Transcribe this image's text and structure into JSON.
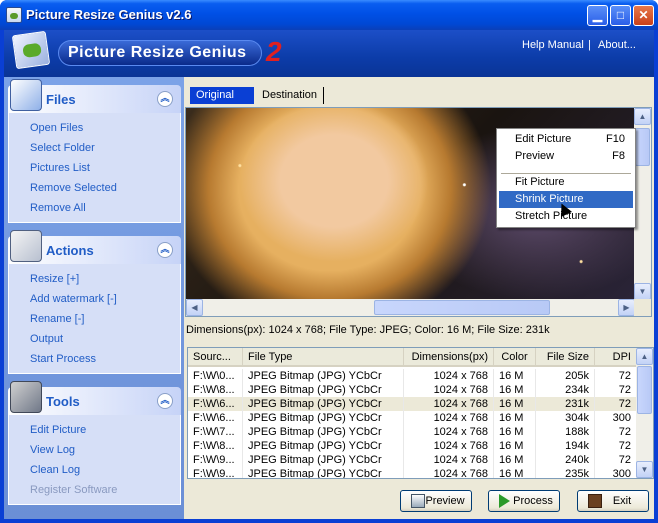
{
  "window": {
    "title": "Picture Resize Genius  v2.6"
  },
  "banner": {
    "logo_text": "Picture Resize Genius",
    "logo_version": "2",
    "help_link": "Help Manual",
    "separator": "|",
    "about_link": "About..."
  },
  "sidebar": {
    "files": {
      "title": "Files",
      "items": [
        "Open Files",
        "Select Folder",
        "Pictures List",
        "Remove Selected",
        "Remove All"
      ]
    },
    "actions": {
      "title": "Actions",
      "items": [
        "Resize [+]",
        "Add watermark [-]",
        "Rename [-]",
        "Output",
        "Start Process"
      ]
    },
    "tools": {
      "title": "Tools",
      "items": [
        "Edit Picture",
        "View Log",
        "Clean Log",
        "Register Software"
      ]
    }
  },
  "tabs": {
    "original": "Original",
    "destination": "Destination"
  },
  "context_menu": {
    "items": [
      {
        "label": "Edit Picture",
        "shortcut": "F10"
      },
      {
        "label": "Preview",
        "shortcut": "F8"
      },
      {
        "label": "Fit Picture",
        "shortcut": ""
      },
      {
        "label": "Shrink Picture",
        "shortcut": ""
      },
      {
        "label": "Stretch Picture",
        "shortcut": ""
      }
    ],
    "highlighted": "Shrink Picture"
  },
  "image_info": "Dimensions(px): 1024 x 768; File Type: JPEG; Color: 16 M; File Size: 231k",
  "table": {
    "columns": [
      "Sourc...",
      "File Type",
      "Dimensions(px)",
      "Color",
      "File Size",
      "DPI"
    ],
    "rows": [
      [
        "F:\\W\\0...",
        "JPEG Bitmap (JPG) YCbCr",
        "1024 x 768",
        "16 M",
        "205k",
        "72"
      ],
      [
        "F:\\W\\8...",
        "JPEG Bitmap (JPG) YCbCr",
        "1024 x 768",
        "16 M",
        "234k",
        "72"
      ],
      [
        "F:\\W\\6...",
        "JPEG Bitmap (JPG) YCbCr",
        "1024 x 768",
        "16 M",
        "231k",
        "72"
      ],
      [
        "F:\\W\\6...",
        "JPEG Bitmap (JPG) YCbCr",
        "1024 x 768",
        "16 M",
        "304k",
        "300"
      ],
      [
        "F:\\W\\7...",
        "JPEG Bitmap (JPG) YCbCr",
        "1024 x 768",
        "16 M",
        "188k",
        "72"
      ],
      [
        "F:\\W\\8...",
        "JPEG Bitmap (JPG) YCbCr",
        "1024 x 768",
        "16 M",
        "194k",
        "72"
      ],
      [
        "F:\\W\\9...",
        "JPEG Bitmap (JPG) YCbCr",
        "1024 x 768",
        "16 M",
        "240k",
        "72"
      ],
      [
        "F:\\W\\9...",
        "JPEG Bitmap (JPG) YCbCr",
        "1024 x 768",
        "16 M",
        "235k",
        "300"
      ]
    ],
    "selected_row": 2
  },
  "buttons": {
    "preview": "Preview",
    "process": "Process",
    "exit": "Exit"
  },
  "colors": {
    "titlebar": "#0050e6",
    "sidebar": "#7ba2e7",
    "link": "#215dc6",
    "highlight": "#316ac5"
  }
}
